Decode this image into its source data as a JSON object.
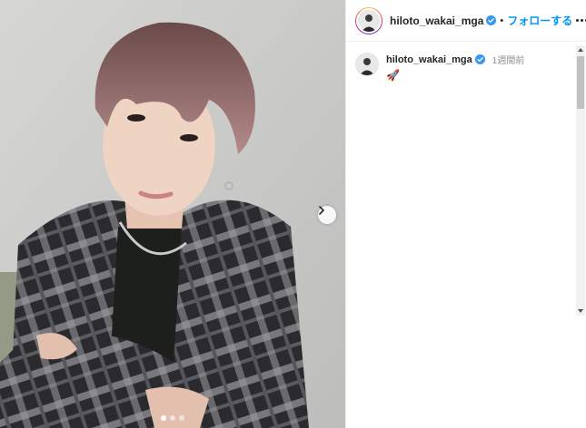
{
  "post": {
    "photo_index": 0,
    "photo_count": 3
  },
  "header": {
    "username": "hiloto_wakai_mga",
    "separator": "•",
    "follow_label": "フォローする"
  },
  "caption": {
    "username": "hiloto_wakai_mga",
    "time": "1週間前",
    "text": "🚀"
  },
  "icons": {
    "verified": "verified-badge-icon",
    "more": "more-options-icon",
    "next": "chevron-right-icon",
    "scroll_up": "scroll-up-arrow-icon",
    "scroll_down": "scroll-down-arrow-icon"
  },
  "colors": {
    "accent": "#0095f6",
    "text": "#262626",
    "muted": "#8e8e8e"
  }
}
